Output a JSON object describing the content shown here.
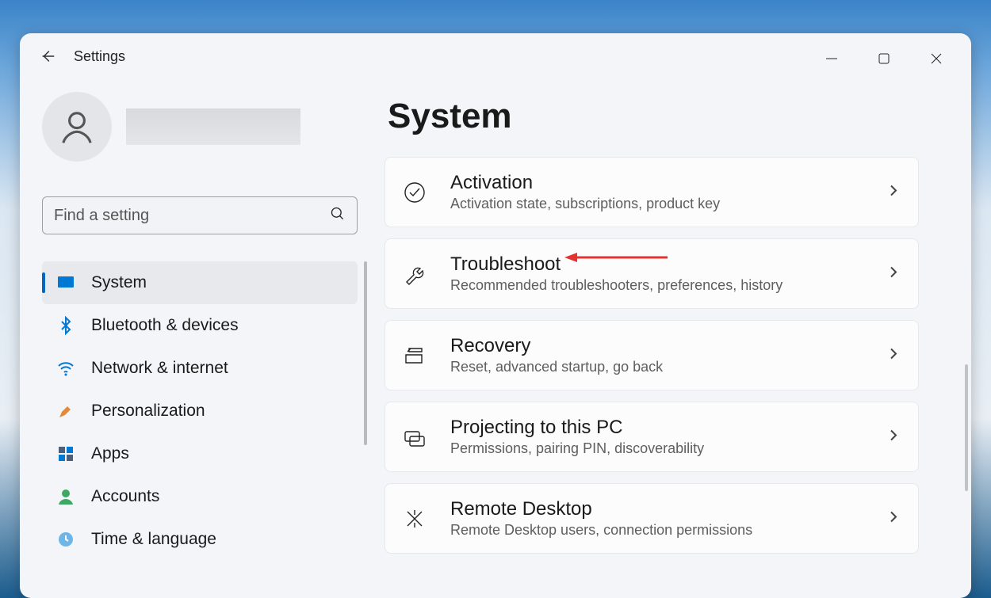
{
  "app": {
    "title": "Settings"
  },
  "search": {
    "placeholder": "Find a setting"
  },
  "page": {
    "title": "System"
  },
  "sidebar": {
    "items": [
      {
        "label": "System"
      },
      {
        "label": "Bluetooth & devices"
      },
      {
        "label": "Network & internet"
      },
      {
        "label": "Personalization"
      },
      {
        "label": "Apps"
      },
      {
        "label": "Accounts"
      },
      {
        "label": "Time & language"
      }
    ]
  },
  "cards": [
    {
      "title": "Activation",
      "subtitle": "Activation state, subscriptions, product key"
    },
    {
      "title": "Troubleshoot",
      "subtitle": "Recommended troubleshooters, preferences, history"
    },
    {
      "title": "Recovery",
      "subtitle": "Reset, advanced startup, go back"
    },
    {
      "title": "Projecting to this PC",
      "subtitle": "Permissions, pairing PIN, discoverability"
    },
    {
      "title": "Remote Desktop",
      "subtitle": "Remote Desktop users, connection permissions"
    }
  ]
}
